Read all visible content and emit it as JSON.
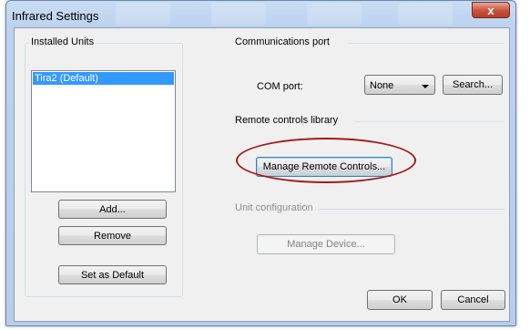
{
  "window": {
    "title": "Infrared Settings",
    "close_glyph": "x"
  },
  "installed_units": {
    "label": "Installed Units",
    "items": [
      "Tira2 (Default)"
    ],
    "add_label": "Add...",
    "remove_label": "Remove",
    "set_default_label": "Set as Default"
  },
  "communications": {
    "label": "Communications port",
    "com_port_label": "COM port:",
    "com_port_value": "None",
    "search_label": "Search..."
  },
  "remote_library": {
    "label": "Remote controls library",
    "manage_label": "Manage Remote Controls..."
  },
  "unit_config": {
    "label": "Unit configuration",
    "manage_device_label": "Manage Device..."
  },
  "footer": {
    "ok_label": "OK",
    "cancel_label": "Cancel"
  },
  "colors": {
    "selection": "#3399ff",
    "annotation": "#a61c1c",
    "close_button": "#c8513b"
  }
}
